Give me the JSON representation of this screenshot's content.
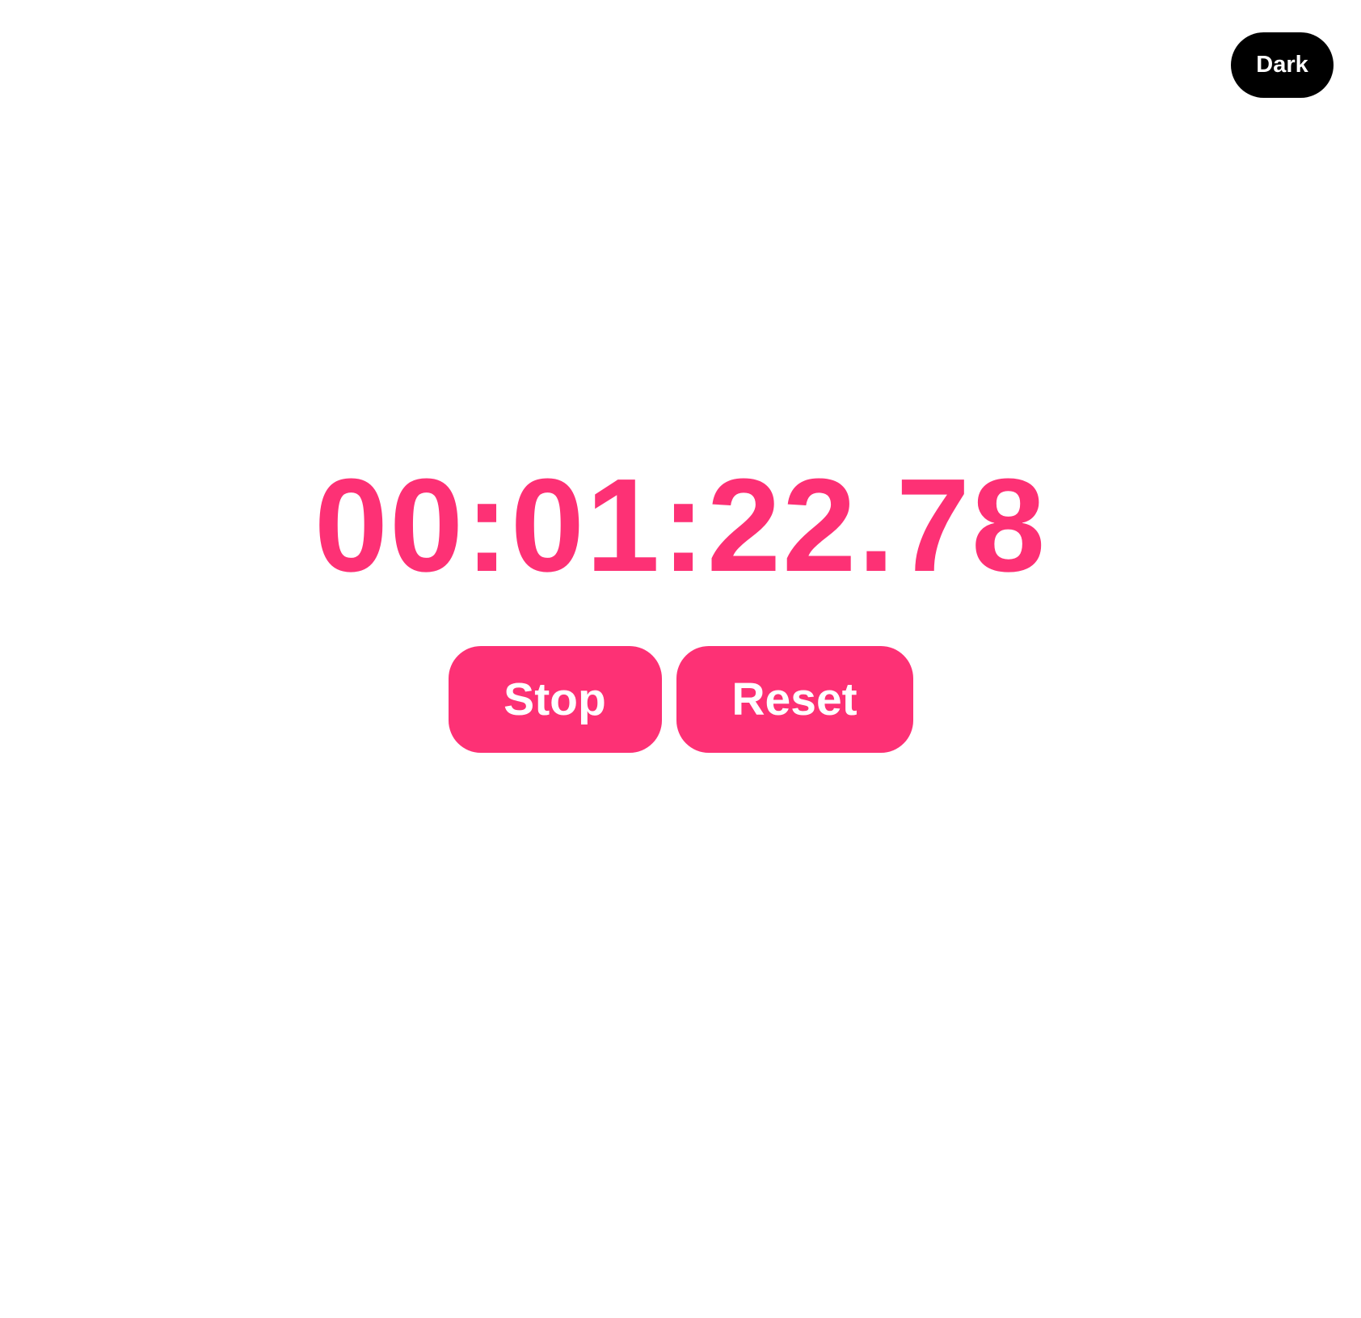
{
  "theme_toggle": {
    "label": "Dark"
  },
  "stopwatch": {
    "display": "00:01:22.78"
  },
  "controls": {
    "stop_label": "Stop",
    "reset_label": "Reset"
  },
  "colors": {
    "accent": "#fd3175",
    "toggle_bg": "#000000",
    "background": "#ffffff"
  }
}
